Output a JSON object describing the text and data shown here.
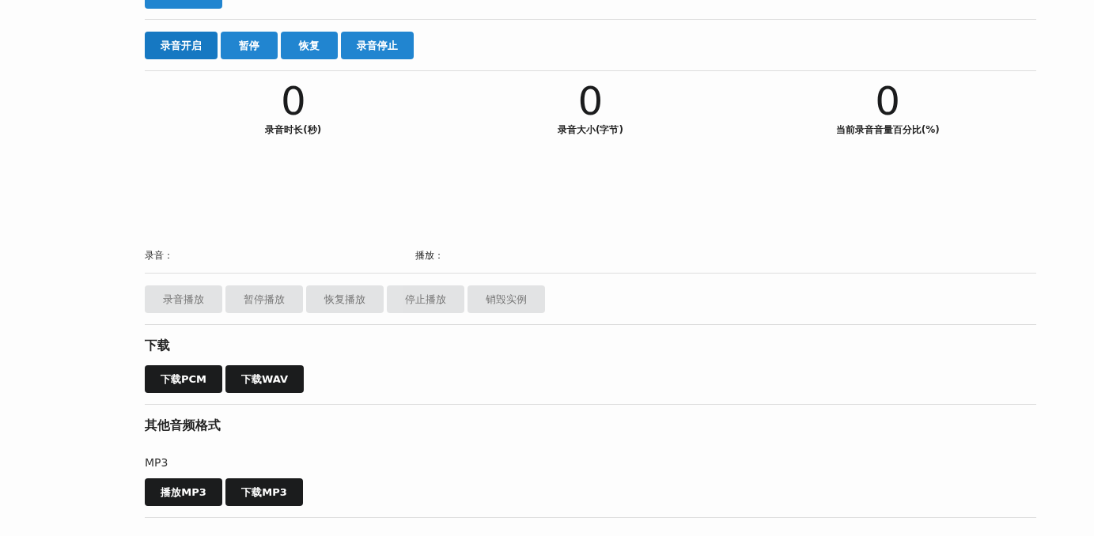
{
  "control_buttons": [
    {
      "label": "录音开启",
      "hovered": true
    },
    {
      "label": "暂停",
      "hovered": false
    },
    {
      "label": "恢复",
      "hovered": false
    },
    {
      "label": "录音停止",
      "hovered": false
    }
  ],
  "stats": [
    {
      "value": "0",
      "label": "录音时长(秒)"
    },
    {
      "value": "0",
      "label": "录音大小(字节)"
    },
    {
      "value": "0",
      "label": "当前录音音量百分比(%)"
    }
  ],
  "players": [
    {
      "label": "录音："
    },
    {
      "label": "播放："
    }
  ],
  "playback_buttons": [
    {
      "label": "录音播放",
      "disabled": true
    },
    {
      "label": "暂停播放",
      "disabled": true
    },
    {
      "label": "恢复播放",
      "disabled": true
    },
    {
      "label": "停止播放",
      "disabled": true
    },
    {
      "label": "销毁实例",
      "disabled": true
    }
  ],
  "download": {
    "heading": "下载",
    "buttons": [
      "下载PCM",
      "下载WAV"
    ]
  },
  "other_formats": {
    "heading": "其他音频格式",
    "format": "MP3",
    "buttons": [
      "播放MP3",
      "下载MP3"
    ]
  }
}
